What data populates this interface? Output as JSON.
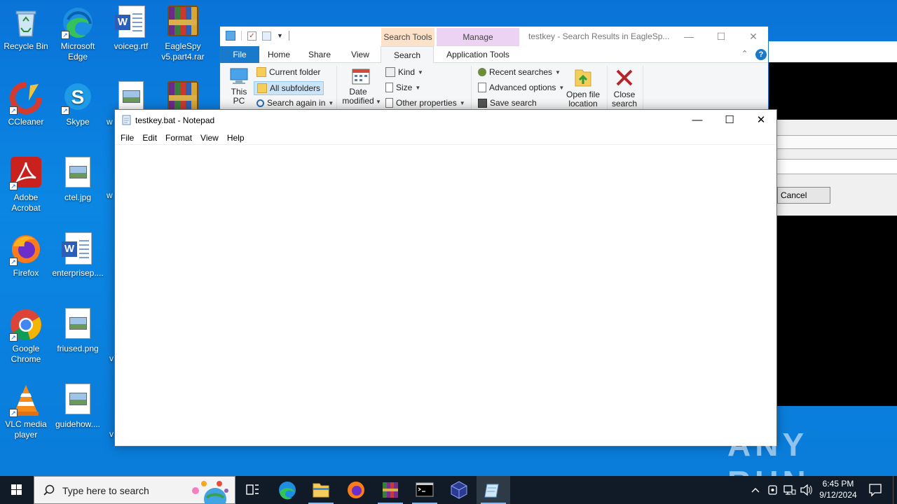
{
  "desktop": {
    "icons": [
      {
        "label": "Recycle Bin"
      },
      {
        "label": "Microsoft Edge"
      },
      {
        "label": "voiceg.rtf"
      },
      {
        "label": "EagleSpy v5.part4.rar"
      },
      {
        "label": "CCleaner"
      },
      {
        "label": "Skype"
      },
      {
        "label": "w"
      },
      {
        "label": "Adobe Acrobat"
      },
      {
        "label": "ctel.jpg"
      },
      {
        "label": "w"
      },
      {
        "label": "Firefox"
      },
      {
        "label": "enterprisep...."
      },
      {
        "label": "Google Chrome"
      },
      {
        "label": "friused.png"
      },
      {
        "label": "v"
      },
      {
        "label": "VLC media player"
      },
      {
        "label": "guidehow...."
      },
      {
        "label": "v"
      }
    ]
  },
  "explorer": {
    "context_tab_search_tools": "Search Tools",
    "context_tab_manage": "Manage",
    "caption": "testkey - Search Results in EagleSp...",
    "tabs": {
      "file": "File",
      "home": "Home",
      "share": "Share",
      "view": "View",
      "search": "Search",
      "application_tools": "Application Tools"
    },
    "ribbon": {
      "this_pc": "This PC",
      "current_folder": "Current folder",
      "all_subfolders": "All subfolders",
      "search_again_in": "Search again in",
      "date_modified": "Date modified",
      "kind": "Kind",
      "size": "Size",
      "other_properties": "Other properties",
      "recent_searches": "Recent searches",
      "advanced_options": "Advanced options",
      "save_search": "Save search",
      "open_file_location": "Open file location",
      "close_search": "Close search"
    }
  },
  "background_dialog": {
    "cancel_label": "Cancel"
  },
  "notepad": {
    "title": "testkey.bat - Notepad",
    "menu": [
      "File",
      "Edit",
      "Format",
      "View",
      "Help"
    ],
    "content": ""
  },
  "taskbar": {
    "search_placeholder": "Type here to search",
    "clock_time": "6:45 PM",
    "clock_date": "9/12/2024"
  },
  "watermark": "ANY RUN",
  "colors": {
    "desktop_bg": "#0a7bd9",
    "explorer_accent": "#1979ca",
    "search_tools_tab": "#fde2c9",
    "manage_tab": "#ecd3f4",
    "taskbar_bg": "#101b27"
  }
}
